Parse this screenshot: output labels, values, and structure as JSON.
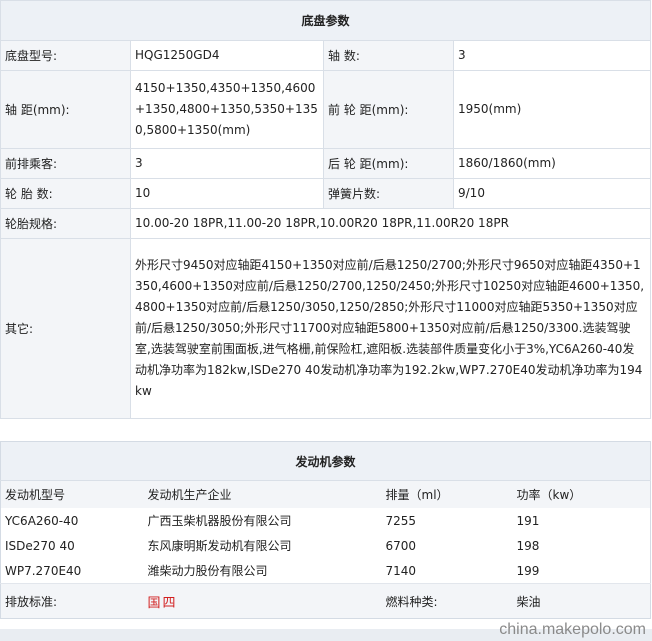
{
  "chassis": {
    "title": "底盘参数",
    "rows": [
      {
        "l1": "底盘型号:",
        "v1": "HQG1250GD4",
        "l2": "轴 数:",
        "v2": "3"
      },
      {
        "l1": "轴 距(mm):",
        "v1": "4150+1350,4350+1350,4600+1350,4800+1350,5350+1350,5800+1350(mm)",
        "l2": "前 轮 距(mm):",
        "v2": "1950(mm)"
      },
      {
        "l1": "前排乘客:",
        "v1": "3",
        "l2": "后 轮 距(mm):",
        "v2": "1860/1860(mm)"
      },
      {
        "l1": "轮 胎 数:",
        "v1": "10",
        "l2": "弹簧片数:",
        "v2": "9/10"
      }
    ],
    "tire_label": "轮胎规格:",
    "tire_value": "10.00-20 18PR,11.00-20 18PR,10.00R20 18PR,11.00R20 18PR",
    "other_label": "其它:",
    "other_value": "外形尺寸9450对应轴距4150+1350对应前/后悬1250/2700;外形尺寸9650对应轴距4350+1350,4600+1350对应前/后悬1250/2700,1250/2450;外形尺寸10250对应轴距4600+1350,4800+1350对应前/后悬1250/3050,1250/2850;外形尺寸11000对应轴距5350+1350对应前/后悬1250/3050;外形尺寸11700对应轴距5800+1350对应前/后悬1250/3300.选装驾驶室,选装驾驶室前围面板,进气格栅,前保险杠,遮阳板.选装部件质量变化小于3%,YC6A260-40发动机净功率为182kw,ISDe270 40发动机净功率为192.2kw,WP7.270E40发动机净功率为194kw"
  },
  "engine": {
    "title": "发动机参数",
    "headers": [
      "发动机型号",
      "发动机生产企业",
      "排量（ml）",
      "功率（kw）"
    ],
    "rows": [
      {
        "model": "YC6A260-40",
        "maker": "广西玉柴机器股份有限公司",
        "disp": "7255",
        "power": "191"
      },
      {
        "model": "ISDe270 40",
        "maker": "东风康明斯发动机有限公司",
        "disp": "6700",
        "power": "198"
      },
      {
        "model": "WP7.270E40",
        "maker": "潍柴动力股份有限公司",
        "disp": "7140",
        "power": "199"
      }
    ],
    "emission_label": "排放标准:",
    "emission_value": "国四",
    "fuel_label": "燃料种类:",
    "fuel_value": "柴油"
  },
  "watermark": "china.makepolo.com",
  "colors": {
    "header_bg": "#edf1f6",
    "label_bg": "#f3f5f8",
    "border": "#d9dfe7",
    "emission_red": "#d21f1f"
  }
}
